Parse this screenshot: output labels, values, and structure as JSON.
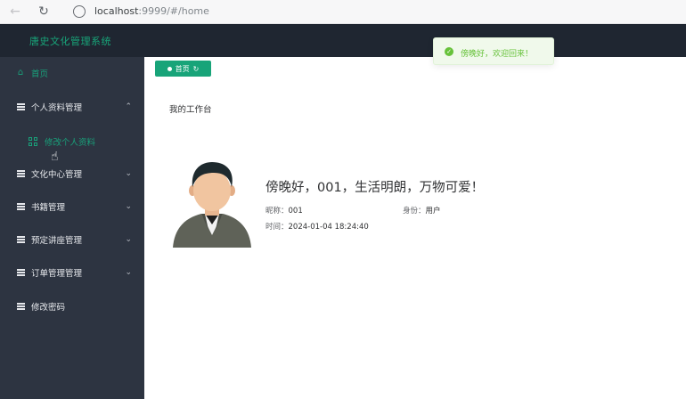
{
  "browser": {
    "url_host": "localhost",
    "url_rest": ":9999/#/home",
    "icons": {
      "back": "arrow-left-icon",
      "reload": "reload-icon",
      "site_info": "info-circle-icon"
    }
  },
  "app": {
    "title": "唐史文化管理系统"
  },
  "sidebar": {
    "home": {
      "label": "首页",
      "icon": "home-icon"
    },
    "items": [
      {
        "label": "个人资料管理",
        "caret": "⌃",
        "expanded": true
      },
      {
        "label": "文化中心管理",
        "caret": "⌄"
      },
      {
        "label": "书籍管理",
        "caret": "⌄"
      },
      {
        "label": "预定讲座管理",
        "caret": "⌄"
      },
      {
        "label": "订单管理管理",
        "caret": "⌄"
      },
      {
        "label": "修改密码"
      }
    ],
    "subitem": {
      "label": "修改个人资料",
      "icon": "grid-icon"
    }
  },
  "main": {
    "tag": {
      "label": "首页",
      "refresh": "↻"
    },
    "workspace_title": "我的工作台",
    "greeting": "傍晚好，001，生活明朗，万物可爱！",
    "nickname_label": "昵称：",
    "nickname_value": "001",
    "role_label": "身份：",
    "role_value": "用户",
    "time_label": "时间：",
    "time_value": "2024-01-04 18:24:40"
  },
  "toast": {
    "text": "傍晚好，欢迎回来！",
    "icon": "check-circle-icon",
    "color": "#67c23a"
  },
  "colors": {
    "accent": "#18a479",
    "sidebar": "#2d3441",
    "header": "#1f2631"
  }
}
